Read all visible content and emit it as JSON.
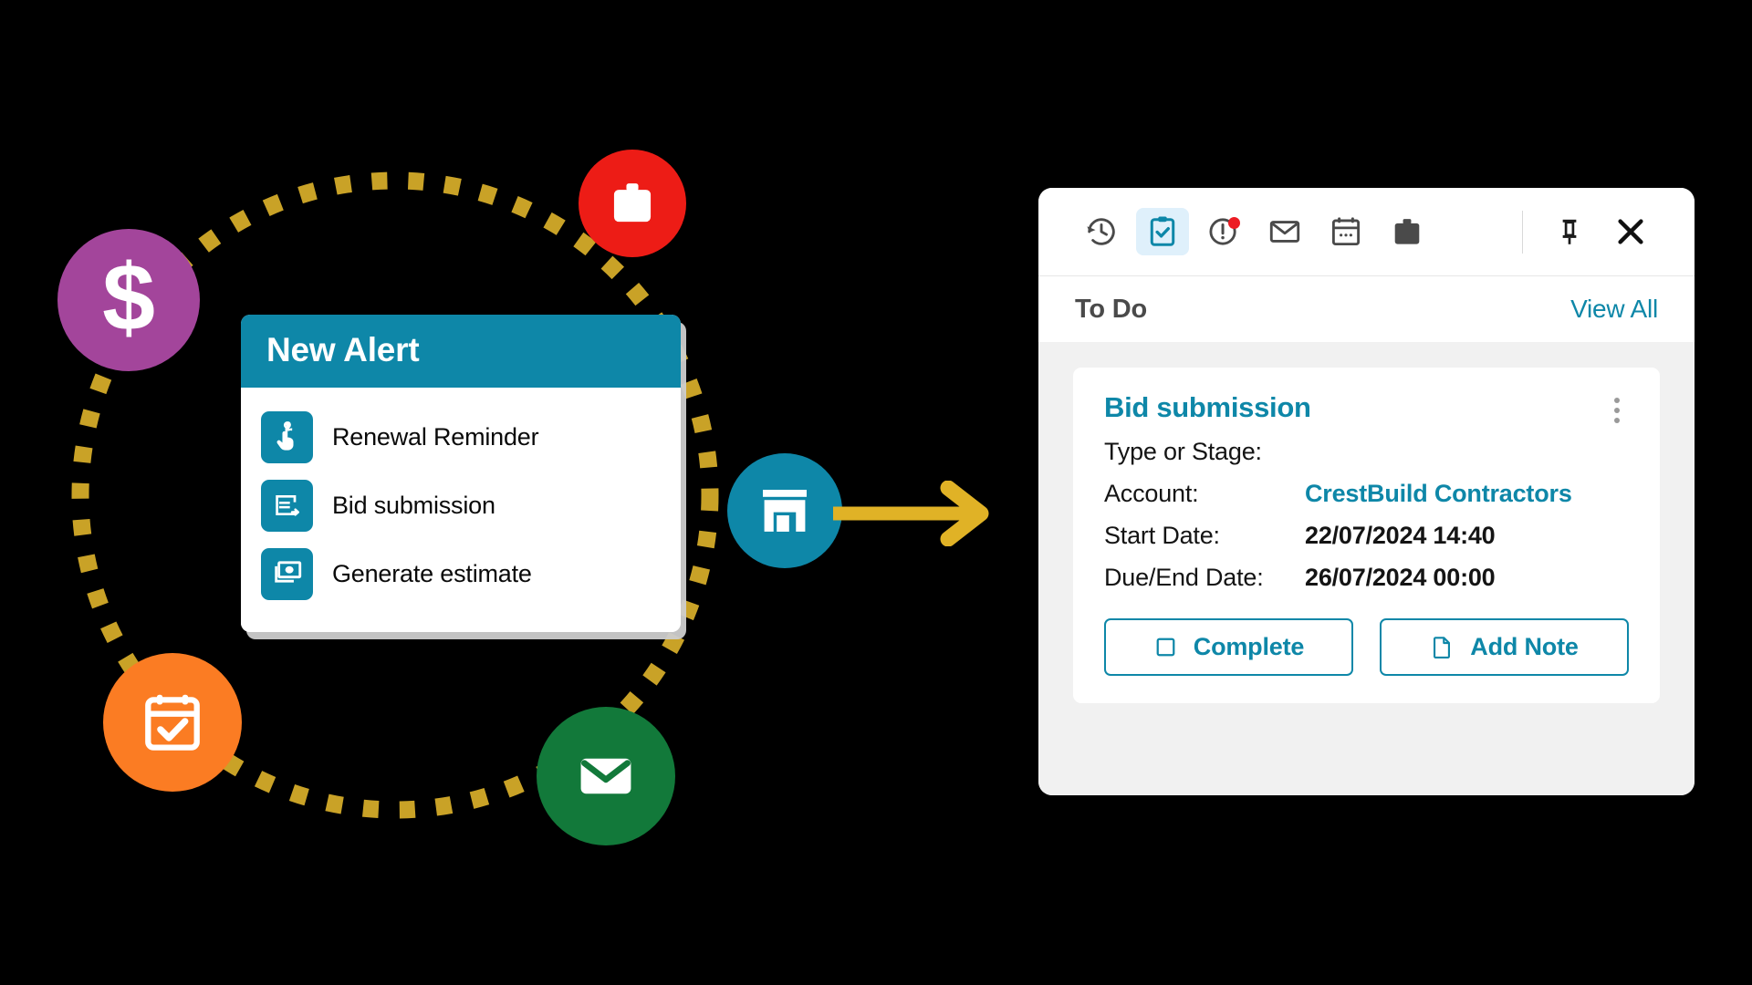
{
  "alert_card": {
    "title": "New Alert",
    "items": [
      {
        "label": "Renewal Reminder",
        "icon": "hand-tap-icon"
      },
      {
        "label": "Bid submission",
        "icon": "submit-arrow-icon"
      },
      {
        "label": "Generate estimate",
        "icon": "banknote-icon"
      }
    ]
  },
  "orbit_nodes": [
    {
      "name": "dollar",
      "icon": "dollar-sign-icon",
      "glyph": "$",
      "color": "#a3459b"
    },
    {
      "name": "briefcase",
      "icon": "briefcase-icon",
      "color": "#ed1c16"
    },
    {
      "name": "store",
      "icon": "store-icon",
      "color": "#0e87a8"
    },
    {
      "name": "mail",
      "icon": "envelope-icon",
      "color": "#12793a"
    },
    {
      "name": "calendar",
      "icon": "calendar-check-icon",
      "color": "#fb7c23"
    }
  ],
  "flow_arrow": {
    "icon": "arrow-right-icon",
    "color": "#e0b226"
  },
  "orbit": {
    "color": "#c9a227",
    "style": "dotted"
  },
  "panel": {
    "toolbar": [
      {
        "icon": "history-icon",
        "label": "History",
        "active": false,
        "badge": false
      },
      {
        "icon": "clipboard-check-icon",
        "label": "To Do",
        "active": true,
        "badge": false
      },
      {
        "icon": "alert-circle-icon",
        "label": "Alerts",
        "active": false,
        "badge": true
      },
      {
        "icon": "envelope-icon",
        "label": "Email",
        "active": false,
        "badge": false
      },
      {
        "icon": "calendar-icon",
        "label": "Calendar",
        "active": false,
        "badge": false
      },
      {
        "icon": "briefcase-icon",
        "label": "Opportunities",
        "active": false,
        "badge": false
      }
    ],
    "toolbar_right": [
      {
        "icon": "pin-icon",
        "label": "Pin"
      },
      {
        "icon": "close-icon",
        "label": "Close"
      }
    ],
    "subhead": {
      "title": "To Do",
      "view_all": "View All"
    },
    "todo": {
      "title": "Bid submission",
      "menu_icon": "kebab-menu-icon",
      "fields": [
        {
          "label": "Type or Stage:",
          "value": "",
          "link": false
        },
        {
          "label": "Account:",
          "value": "CrestBuild Contractors",
          "link": true
        },
        {
          "label": "Start Date:",
          "value": "22/07/2024 14:40",
          "link": false
        },
        {
          "label": "Due/End Date:",
          "value": "26/07/2024 00:00",
          "link": false
        }
      ],
      "actions": [
        {
          "label": "Complete",
          "icon": "checkbox-empty-icon"
        },
        {
          "label": "Add Note",
          "icon": "document-icon"
        }
      ]
    }
  },
  "colors": {
    "teal": "#0e87a8",
    "gold": "#c9a227",
    "purple": "#a3459b",
    "red": "#ed1c16",
    "green": "#12793a",
    "orange": "#fb7c23",
    "panel_bg": "#f1f1f1",
    "badge_red": "#ec1c24"
  }
}
